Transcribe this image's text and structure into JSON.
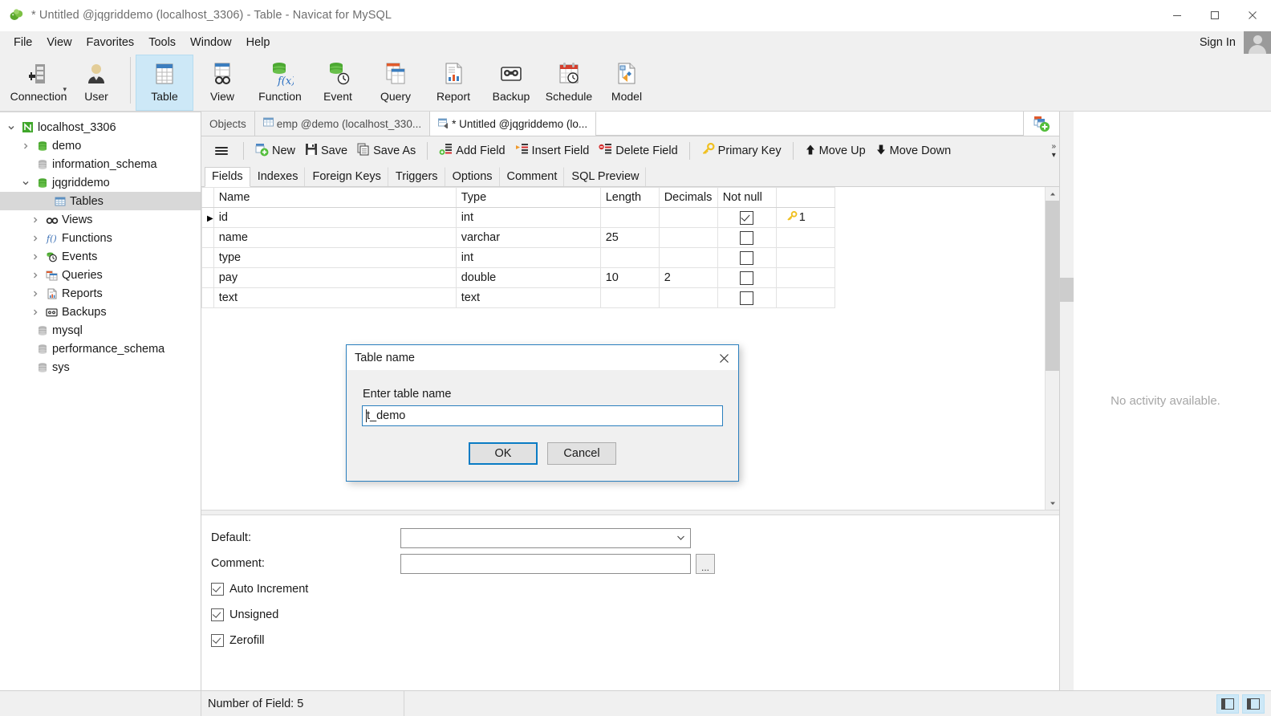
{
  "window": {
    "title": "* Untitled @jqgriddemo (localhost_3306) - Table - Navicat for MySQL",
    "minimize": "—",
    "maximize": "□",
    "close": "✕"
  },
  "menubar": {
    "items": [
      "File",
      "View",
      "Favorites",
      "Tools",
      "Window",
      "Help"
    ],
    "sign_in": "Sign In"
  },
  "toolbar": {
    "buttons": [
      {
        "label": "Connection",
        "icon": "connection-icon",
        "selected": false,
        "has_caret": true
      },
      {
        "label": "User",
        "icon": "user-icon",
        "selected": false,
        "has_caret": false
      },
      {
        "label": "Table",
        "icon": "table-icon",
        "selected": true,
        "has_caret": false
      },
      {
        "label": "View",
        "icon": "view-icon",
        "selected": false,
        "has_caret": false
      },
      {
        "label": "Function",
        "icon": "function-icon",
        "selected": false,
        "has_caret": false
      },
      {
        "label": "Event",
        "icon": "event-icon",
        "selected": false,
        "has_caret": false
      },
      {
        "label": "Query",
        "icon": "query-icon",
        "selected": false,
        "has_caret": false
      },
      {
        "label": "Report",
        "icon": "report-icon",
        "selected": false,
        "has_caret": false
      },
      {
        "label": "Backup",
        "icon": "backup-icon",
        "selected": false,
        "has_caret": false
      },
      {
        "label": "Schedule",
        "icon": "schedule-icon",
        "selected": false,
        "has_caret": false
      },
      {
        "label": "Model",
        "icon": "model-icon",
        "selected": false,
        "has_caret": false
      }
    ]
  },
  "sidebar": {
    "items": [
      {
        "label": "localhost_3306",
        "indent": 0,
        "chevron": "down",
        "icon": "server-icon",
        "selected": false
      },
      {
        "label": "demo",
        "indent": 1,
        "chevron": "right",
        "icon": "database-icon",
        "selected": false
      },
      {
        "label": "information_schema",
        "indent": 1,
        "chevron": "none",
        "icon": "database-gray-icon",
        "selected": false
      },
      {
        "label": "jqgriddemo",
        "indent": 1,
        "chevron": "down",
        "icon": "database-icon",
        "selected": false
      },
      {
        "label": "Tables",
        "indent": 2,
        "chevron": "none",
        "icon": "tables-icon",
        "selected": true
      },
      {
        "label": "Views",
        "indent": 2,
        "chevron": "right",
        "icon": "views-icon",
        "selected": false
      },
      {
        "label": "Functions",
        "indent": 2,
        "chevron": "right",
        "icon": "functions-icon",
        "selected": false
      },
      {
        "label": "Events",
        "indent": 2,
        "chevron": "right",
        "icon": "events-icon",
        "selected": false
      },
      {
        "label": "Queries",
        "indent": 2,
        "chevron": "right",
        "icon": "queries-icon",
        "selected": false
      },
      {
        "label": "Reports",
        "indent": 2,
        "chevron": "right",
        "icon": "reports-icon",
        "selected": false
      },
      {
        "label": "Backups",
        "indent": 2,
        "chevron": "right",
        "icon": "backups-icon",
        "selected": false
      },
      {
        "label": "mysql",
        "indent": 1,
        "chevron": "none",
        "icon": "database-gray-icon",
        "selected": false
      },
      {
        "label": "performance_schema",
        "indent": 1,
        "chevron": "none",
        "icon": "database-gray-icon",
        "selected": false
      },
      {
        "label": "sys",
        "indent": 1,
        "chevron": "none",
        "icon": "database-gray-icon",
        "selected": false
      }
    ]
  },
  "doc_tabs": [
    {
      "label": "Objects",
      "icon": "none",
      "active": false
    },
    {
      "label": "emp @demo (localhost_330...",
      "icon": "table-small-icon",
      "active": false
    },
    {
      "label": "* Untitled @jqgriddemo (lo...",
      "icon": "newtable-small-icon",
      "active": true
    }
  ],
  "action_bar": {
    "menu_icon": "hamburger-icon",
    "buttons": [
      {
        "label": "New",
        "icon": "new-icon"
      },
      {
        "label": "Save",
        "icon": "save-icon"
      },
      {
        "label": "Save As",
        "icon": "save-as-icon"
      },
      {
        "label": "Add Field",
        "icon": "add-field-icon"
      },
      {
        "label": "Insert Field",
        "icon": "insert-field-icon"
      },
      {
        "label": "Delete Field",
        "icon": "delete-field-icon"
      },
      {
        "label": "Primary Key",
        "icon": "key-icon"
      },
      {
        "label": "Move Up",
        "icon": "arrow-up-icon"
      },
      {
        "label": "Move Down",
        "icon": "arrow-down-icon"
      }
    ],
    "overflow": "»"
  },
  "inner_tabs": [
    {
      "label": "Fields",
      "active": true
    },
    {
      "label": "Indexes",
      "active": false
    },
    {
      "label": "Foreign Keys",
      "active": false
    },
    {
      "label": "Triggers",
      "active": false
    },
    {
      "label": "Options",
      "active": false
    },
    {
      "label": "Comment",
      "active": false
    },
    {
      "label": "SQL Preview",
      "active": false
    }
  ],
  "fields_grid": {
    "columns": [
      "Name",
      "Type",
      "Length",
      "Decimals",
      "Not null",
      ""
    ],
    "rows": [
      {
        "current": true,
        "name": "id",
        "type": "int",
        "length": "",
        "decimals": "",
        "not_null": true,
        "key": "1"
      },
      {
        "current": false,
        "name": "name",
        "type": "varchar",
        "length": "25",
        "decimals": "",
        "not_null": false,
        "key": ""
      },
      {
        "current": false,
        "name": "type",
        "type": "int",
        "length": "",
        "decimals": "",
        "not_null": false,
        "key": ""
      },
      {
        "current": false,
        "name": "pay",
        "type": "double",
        "length": "10",
        "decimals": "2",
        "not_null": false,
        "key": ""
      },
      {
        "current": false,
        "name": "text",
        "type": "text",
        "length": "",
        "decimals": "",
        "not_null": false,
        "key": ""
      }
    ]
  },
  "properties": {
    "default_label": "Default:",
    "default_value": "",
    "comment_label": "Comment:",
    "comment_value": "",
    "browse_button": "...",
    "checkboxes": [
      {
        "label": "Auto Increment",
        "checked": true
      },
      {
        "label": "Unsigned",
        "checked": true
      },
      {
        "label": "Zerofill",
        "checked": true
      }
    ]
  },
  "right_panel": {
    "empty_message": "No activity available."
  },
  "status_bar": {
    "field_count": "Number of Field: 5",
    "toggles": [
      "left-panel-toggle-icon",
      "right-panel-toggle-icon"
    ]
  },
  "dialog": {
    "title": "Table name",
    "close": "✕",
    "label": "Enter table name",
    "value": "t_demo",
    "ok": "OK",
    "cancel": "Cancel"
  },
  "colors": {
    "accent": "#0a7cc4",
    "selection": "#cde8f7",
    "chrome": "#f0f0f0",
    "tree_selection": "#d8d8d8"
  }
}
